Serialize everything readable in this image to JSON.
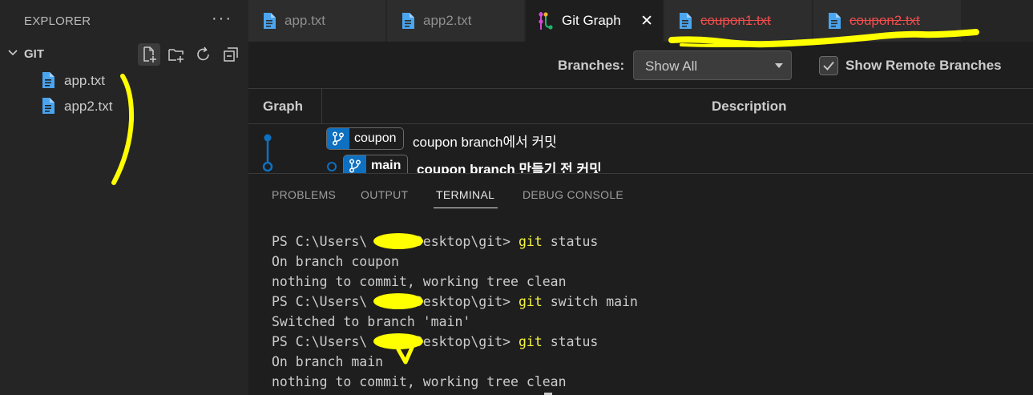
{
  "sidebar": {
    "title": "EXPLORER",
    "more": "···",
    "folder": "GIT",
    "files": [
      {
        "name": "app.txt"
      },
      {
        "name": "app2.txt"
      }
    ]
  },
  "tabs": [
    {
      "label": "app.txt"
    },
    {
      "label": "app2.txt"
    },
    {
      "label": "Git Graph",
      "close": "✕"
    },
    {
      "label": "coupon1.txt"
    },
    {
      "label": "coupon2.txt"
    }
  ],
  "git_graph": {
    "branches_label": "Branches:",
    "branches_value": "Show All",
    "remote_label": "Show Remote Branches",
    "show_remote_checked": true,
    "columns": {
      "graph": "Graph",
      "description": "Description"
    },
    "commits": [
      {
        "branch": "coupon",
        "message": "coupon branch에서 커밋"
      },
      {
        "branch": "main",
        "message": "coupon branch 만들기 전 커밋"
      }
    ]
  },
  "panel": {
    "tabs": [
      "PROBLEMS",
      "OUTPUT",
      "TERMINAL",
      "DEBUG CONSOLE"
    ],
    "active_tab": "TERMINAL"
  },
  "terminal": {
    "prompt_a": "PS C:\\Users\\",
    "prompt_b": "\\Desktop\\git> ",
    "lines": [
      {
        "type": "cmd",
        "cmd": "git",
        "args": " status"
      },
      {
        "type": "out",
        "text": "On branch coupon"
      },
      {
        "type": "out",
        "text": "nothing to commit, working tree clean"
      },
      {
        "type": "cmd",
        "cmd": "git",
        "args": " switch main"
      },
      {
        "type": "out",
        "text": "Switched to branch 'main'"
      },
      {
        "type": "cmd",
        "cmd": "git",
        "args": " status"
      },
      {
        "type": "out",
        "text": "On branch main"
      },
      {
        "type": "out",
        "text": "nothing to commit, working tree clean"
      }
    ]
  },
  "colors": {
    "accent": "#0e70c0",
    "deleted": "#f14c4c",
    "command": "#f5f543",
    "annotation": "#ffff00"
  }
}
